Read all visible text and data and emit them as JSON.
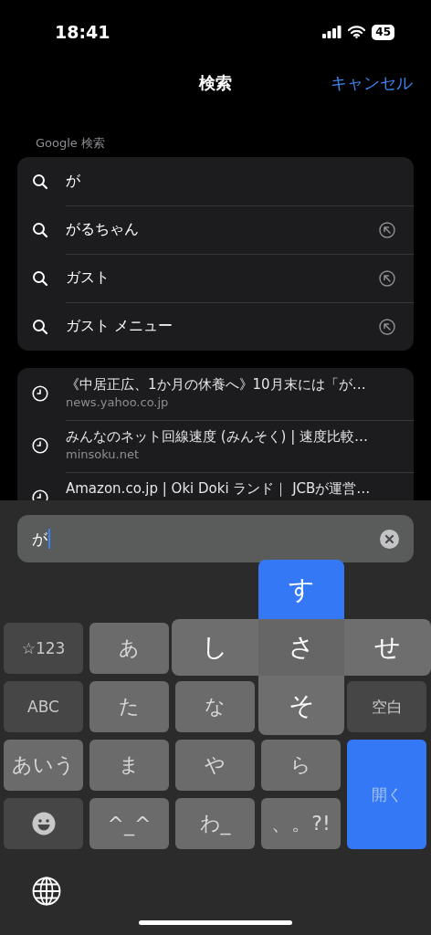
{
  "status_bar": {
    "time": "18:41",
    "battery": "45"
  },
  "header": {
    "title": "検索",
    "cancel": "キャンセル"
  },
  "google_section": {
    "label": "Google 検索",
    "suggestions": [
      {
        "text": "が",
        "fill_button": false
      },
      {
        "text": "がるちゃん",
        "fill_button": true
      },
      {
        "text": "ガスト",
        "fill_button": true
      },
      {
        "text": "ガスト メニュー",
        "fill_button": true
      }
    ]
  },
  "history": [
    {
      "title": "《中居正広、1か月の休養へ》10月末には「が…",
      "url": "news.yahoo.co.jp"
    },
    {
      "title": "みんなのネット回線速度 (みんそく) | 速度比較…",
      "url": "minsoku.net"
    },
    {
      "title": "Amazon.co.jp | Oki Doki ランド｜ JCBが運営…"
    }
  ],
  "search_field": {
    "value": "が"
  },
  "flick_popup": [
    {
      "label": "す",
      "kind": "up",
      "selected": true
    },
    {
      "label": "し",
      "kind": "left",
      "selected": false
    },
    {
      "label": "さ",
      "kind": "center",
      "selected": false
    },
    {
      "label": "せ",
      "kind": "right",
      "selected": false
    },
    {
      "label": "そ",
      "kind": "down",
      "selected": false
    }
  ],
  "keys": [
    {
      "label": "☆123",
      "kind": "function"
    },
    {
      "label": "あ",
      "kind": "char"
    },
    {
      "kind": "covered"
    },
    {
      "kind": "covered"
    },
    {
      "kind": "covered"
    },
    {
      "label": "ABC",
      "kind": "function"
    },
    {
      "label": "た",
      "kind": "char"
    },
    {
      "label": "な",
      "kind": "char"
    },
    {
      "kind": "covered"
    },
    {
      "label": "空白",
      "kind": "function"
    },
    {
      "label": "あいう",
      "kind": "char"
    },
    {
      "label": "ま",
      "kind": "char"
    },
    {
      "label": "や",
      "kind": "char"
    },
    {
      "label": "ら",
      "kind": "char"
    },
    {
      "label": "開く",
      "kind": "return"
    },
    {
      "kind": "emoji"
    },
    {
      "label": "^_^",
      "kind": "char"
    },
    {
      "label": "わ_",
      "kind": "char"
    },
    {
      "label": "、。?!",
      "kind": "char"
    }
  ]
}
